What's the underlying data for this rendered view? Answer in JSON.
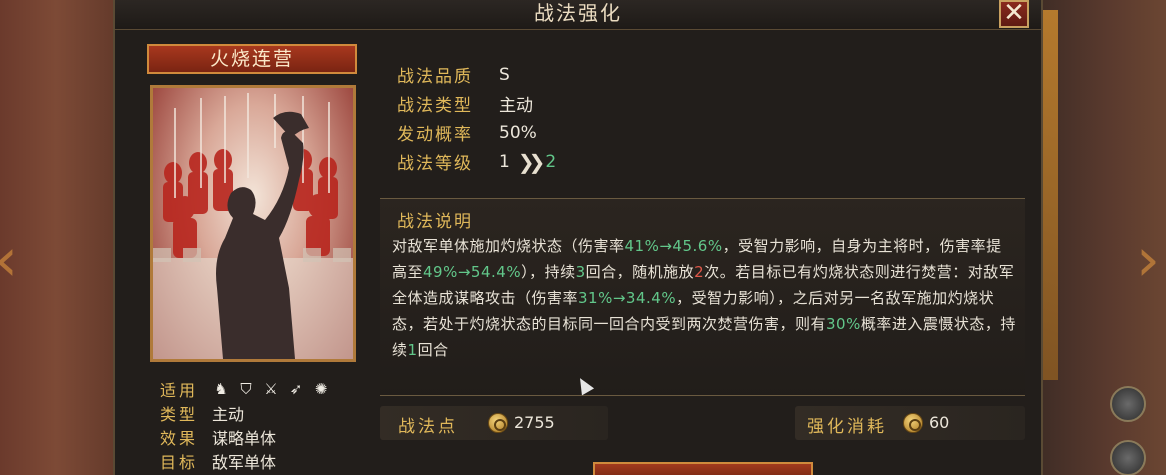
{
  "window": {
    "title": "战法强化",
    "close_icon": "close-icon"
  },
  "skill": {
    "name": "火烧连营",
    "card_art": "silhouette-commander-with-soldiers"
  },
  "card_info": {
    "applicable_label": "适用",
    "applicable_icons": [
      "cavalry-icon",
      "shield-icon",
      "crossed-swords-icon",
      "spear-icon",
      "wheel-icon"
    ],
    "type_label": "类型",
    "type_value": "主动",
    "effect_label": "效果",
    "effect_value": "谋略单体",
    "target_label": "目标",
    "target_value": "敌军单体"
  },
  "attributes": {
    "quality_label": "战法品质",
    "quality_value": "S",
    "type_label": "战法类型",
    "type_value": "主动",
    "rate_label": "发动概率",
    "rate_value": "50%",
    "level_label": "战法等级",
    "level_current": "1",
    "level_next": "2"
  },
  "description": {
    "title": "战法说明",
    "segments": [
      {
        "t": "对敌军单体施加灼烧状态（伤害率",
        "c": ""
      },
      {
        "t": "41%→45.6%",
        "c": "g"
      },
      {
        "t": "，受智力影响，自身为主将时，伤害率提高至",
        "c": ""
      },
      {
        "t": "49%→54.4%",
        "c": "g"
      },
      {
        "t": "），持续",
        "c": ""
      },
      {
        "t": "3",
        "c": "g"
      },
      {
        "t": "回合，随机施放",
        "c": ""
      },
      {
        "t": "2",
        "c": "r"
      },
      {
        "t": "次。若目标已有灼烧状态则进行焚营：对敌军全体造成谋略攻击（伤害率",
        "c": ""
      },
      {
        "t": "31%→34.4%",
        "c": "g"
      },
      {
        "t": "，受智力影响），之后对另一名敌军施加灼烧状态，若处于灼烧状态的目标同一回合内受到两次焚营伤害，则有",
        "c": ""
      },
      {
        "t": "30%",
        "c": "g"
      },
      {
        "t": "概率进入震慑状态，持续",
        "c": ""
      },
      {
        "t": "1",
        "c": "g"
      },
      {
        "t": "回合",
        "c": ""
      }
    ]
  },
  "footer": {
    "points_label": "战法点",
    "points_value": "2755",
    "cost_label": "强化消耗",
    "cost_value": "60"
  },
  "colors": {
    "gold_label": "#e0b85a",
    "green_value": "#62c78a",
    "red_value": "#e0584a",
    "panel_bg": "#221e1b"
  }
}
